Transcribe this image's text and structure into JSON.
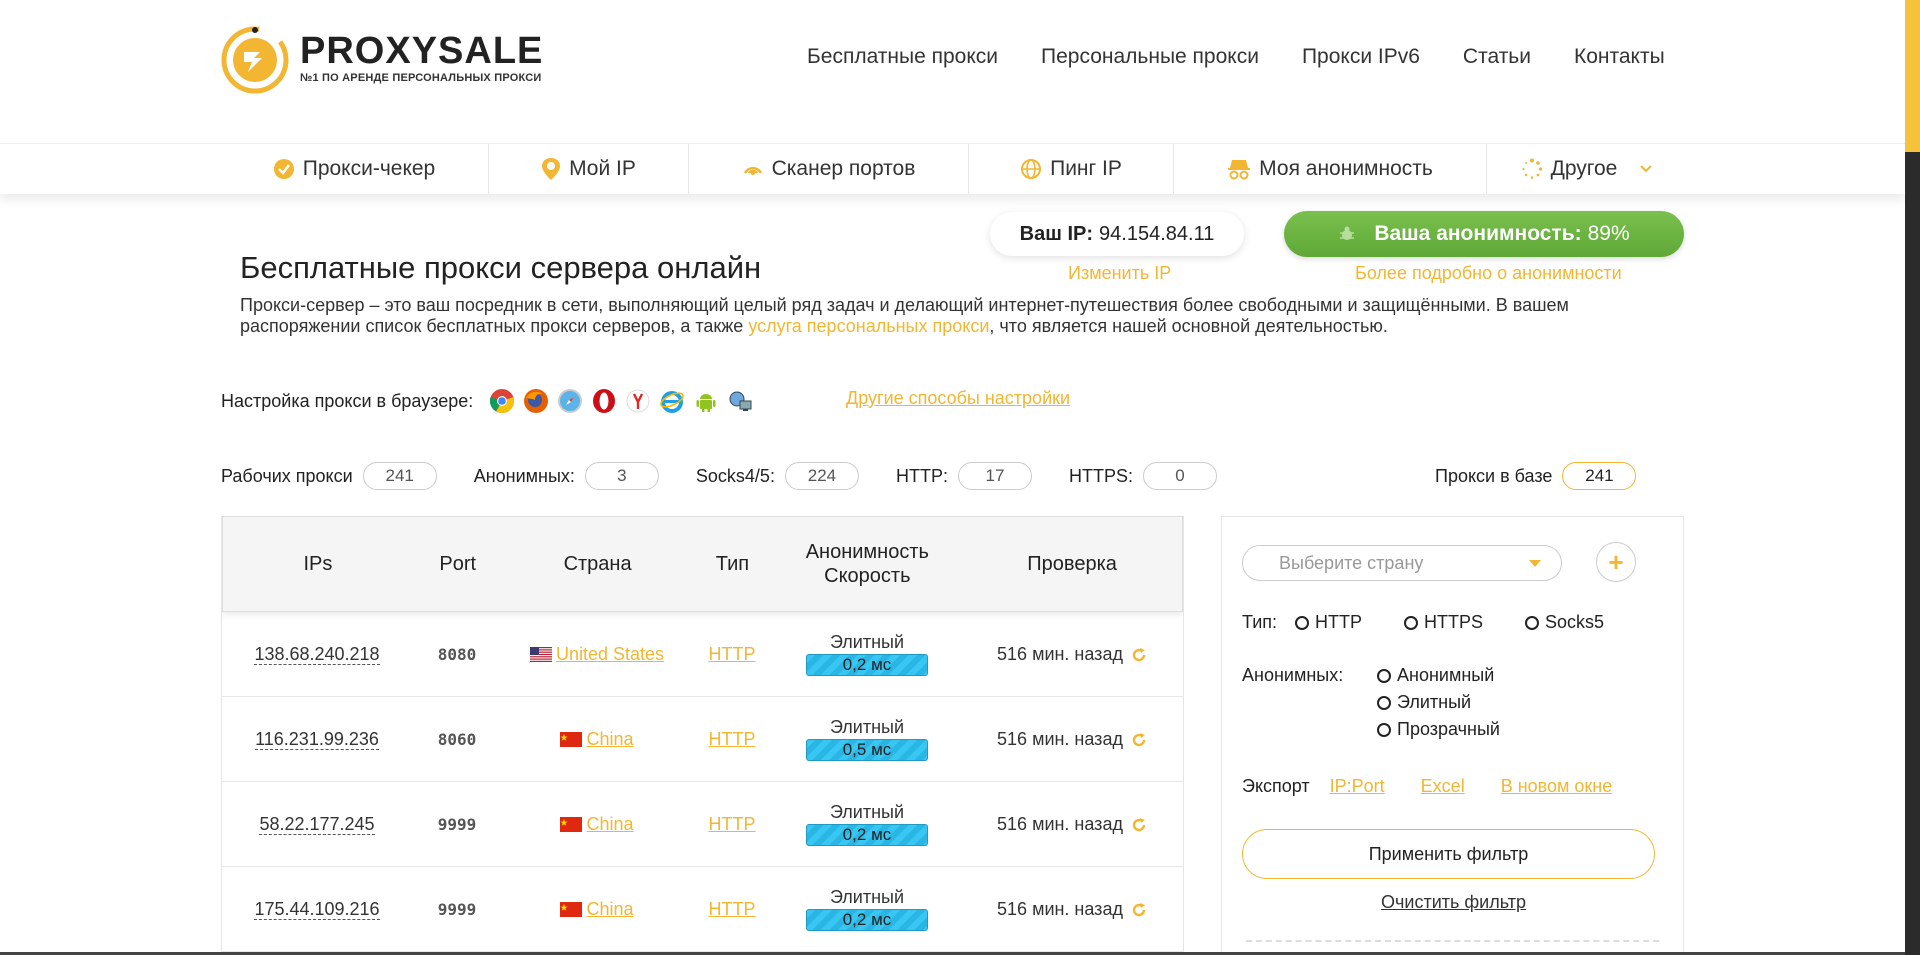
{
  "brand": {
    "name": "PROXYSALE",
    "tagline": "№1 ПО АРЕНДЕ ПЕРСОНАЛЬНЫХ ПРОКСИ",
    "accent": "#f2b632",
    "green": "#6ab440"
  },
  "topnav": [
    "Бесплатные прокси",
    "Персональные прокси",
    "Прокси IPv6",
    "Статьи",
    "Контакты"
  ],
  "subnav": [
    {
      "label": "Прокси-чекер",
      "icon": "check-circle-icon"
    },
    {
      "label": "Мой IP",
      "icon": "location-pin-icon"
    },
    {
      "label": "Сканер портов",
      "icon": "radar-icon"
    },
    {
      "label": "Пинг IP",
      "icon": "globe-icon"
    },
    {
      "label": "Моя анонимность",
      "icon": "incognito-icon"
    },
    {
      "label": "Другое",
      "icon": "spinner-icon"
    }
  ],
  "ip_info": {
    "label": "Ваш IP:",
    "value": "94.154.84.11",
    "change": "Изменить IP"
  },
  "anonymity": {
    "label": "Ваша анонимность:",
    "value": "89%",
    "more": "Более подробно о анонимности"
  },
  "page": {
    "title": "Бесплатные прокси сервера онлайн",
    "intro_1": "Прокси-сервер – это ваш посредник в сети, выполняющий целый ряд задач и делающий интернет-путешествия более свободными и защищёнными. В вашем распоряжении список бесплатных прокси серверов, а также ",
    "intro_link": "услуга персональных прокси",
    "intro_2": ", что является нашей основной деятельностью."
  },
  "browser_setup": {
    "label": "Настройка прокси в браузере:",
    "browsers": [
      "chrome-icon",
      "firefox-icon",
      "safari-icon",
      "opera-icon",
      "yandex-icon",
      "ie-icon",
      "android-icon",
      "windows-network-icon"
    ],
    "other_ways": "Другие способы настройки"
  },
  "stats": [
    {
      "label": "Рабочих прокси",
      "value": "241"
    },
    {
      "label": "Анонимных:",
      "value": "3"
    },
    {
      "label": "Socks4/5:",
      "value": "224"
    },
    {
      "label": "HTTP:",
      "value": "17"
    },
    {
      "label": "HTTPS:",
      "value": "0"
    }
  ],
  "db_stat": {
    "label": "Прокси в базе",
    "value": "241"
  },
  "table": {
    "headers": {
      "ip": "IPs",
      "port": "Port",
      "country": "Страна",
      "type": "Тип",
      "anon_1": "Анонимность",
      "anon_2": "Скорость",
      "check": "Проверка"
    },
    "rows": [
      {
        "ip": "138.68.240.218",
        "port": "8080",
        "country": "United States",
        "flag": "us",
        "type": "HTTP",
        "anon": "Элитный",
        "speed": "0,2 мс",
        "check": "516 мин. назад"
      },
      {
        "ip": "116.231.99.236",
        "port": "8060",
        "country": "China",
        "flag": "cn",
        "type": "HTTP",
        "anon": "Элитный",
        "speed": "0,5 мс",
        "check": "516 мин. назад"
      },
      {
        "ip": "58.22.177.245",
        "port": "9999",
        "country": "China",
        "flag": "cn",
        "type": "HTTP",
        "anon": "Элитный",
        "speed": "0,2 мс",
        "check": "516 мин. назад"
      },
      {
        "ip": "175.44.109.216",
        "port": "9999",
        "country": "China",
        "flag": "cn",
        "type": "HTTP",
        "anon": "Элитный",
        "speed": "0,2 мс",
        "check": "516 мин. назад"
      }
    ]
  },
  "filter": {
    "country_placeholder": "Выберите страну",
    "type_label": "Тип:",
    "types": [
      "HTTP",
      "HTTPS",
      "Socks5"
    ],
    "anon_label": "Анонимных:",
    "anon_options": [
      "Анонимный",
      "Элитный",
      "Прозрачный"
    ],
    "export_label": "Экспорт",
    "export_links": [
      "IP:Port",
      "Excel",
      "В новом окне"
    ],
    "apply": "Применить фильтр",
    "clear": "Очистить фильтр"
  }
}
